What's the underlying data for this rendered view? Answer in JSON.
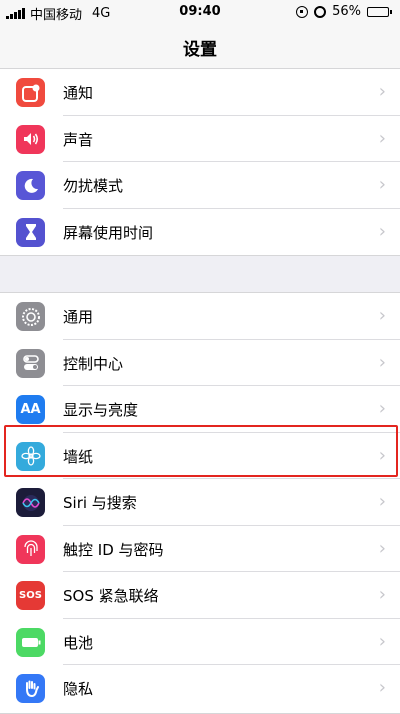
{
  "status_bar": {
    "carrier": "中国移动",
    "network": "4G",
    "time": "09:40",
    "battery": "56%",
    "battery_level": 0.56
  },
  "nav": {
    "title": "设置"
  },
  "groups": [
    [
      {
        "label": "通知",
        "icon": "notifications-icon",
        "color": "#f04a3e"
      },
      {
        "label": "声音",
        "icon": "sounds-icon",
        "color": "#f0365a"
      },
      {
        "label": "勿扰模式",
        "icon": "do-not-disturb-moon-icon",
        "color": "#5856d6"
      },
      {
        "label": "屏幕使用时间",
        "icon": "screen-time-hourglass-icon",
        "color": "#5452d0"
      }
    ],
    [
      {
        "label": "通用",
        "icon": "general-gear-icon",
        "color": "#8e8e93"
      },
      {
        "label": "控制中心",
        "icon": "control-center-toggles-icon",
        "color": "#8e8e93"
      },
      {
        "label": "显示与亮度",
        "icon": "display-brightness-aa-icon",
        "color": "#1f7cf0"
      },
      {
        "label": "墙纸",
        "icon": "wallpaper-flower-icon",
        "color": "#34aadc"
      },
      {
        "label": "Siri 与搜索",
        "icon": "siri-icon",
        "color": "#1c1c3a"
      },
      {
        "label": "触控 ID 与密码",
        "icon": "touch-id-fingerprint-icon",
        "color": "#f0365a"
      },
      {
        "label": "SOS 紧急联络",
        "icon": "sos-icon",
        "color": "#e53935",
        "icon_text": "SOS"
      },
      {
        "label": "电池",
        "icon": "battery-icon",
        "color": "#4cd964"
      },
      {
        "label": "隐私",
        "icon": "privacy-hand-icon",
        "color": "#3478f6"
      }
    ]
  ],
  "chevron": "›",
  "highlight_color": "#e3251f",
  "display_icon_text": "AA"
}
